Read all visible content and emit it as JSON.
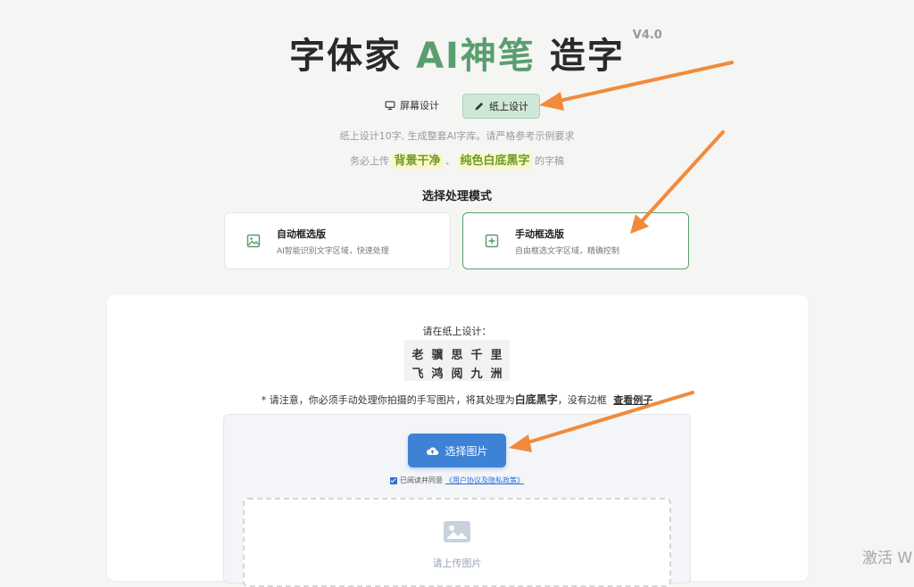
{
  "header": {
    "title_prefix": "字体家",
    "title_ai": "AI神笔",
    "title_suffix": "造字",
    "version": "V4.0"
  },
  "mode_tabs": [
    {
      "label": "屏幕设计",
      "icon": "monitor-icon",
      "active": false
    },
    {
      "label": "纸上设计",
      "icon": "pencil-icon",
      "active": true
    }
  ],
  "hints": {
    "line1": "纸上设计10字, 生成整套AI字库。请严格参考示例要求",
    "line2_prefix": "务必上传",
    "highlight1": "背景干净",
    "separator": "、",
    "highlight2": "纯色白底黑字",
    "line2_suffix": "的字稿"
  },
  "processing": {
    "section_title": "选择处理模式",
    "options": [
      {
        "title": "自动框选版",
        "desc": "AI智能识别文字区域，快速处理",
        "icon": "image-icon",
        "selected": false
      },
      {
        "title": "手动框选版",
        "desc": "自由框选文字区域，精确控制",
        "icon": "plus-square-icon",
        "selected": true
      }
    ]
  },
  "upload_panel": {
    "label": "请在纸上设计：",
    "sample_rows": [
      [
        "老",
        "骥",
        "思",
        "千",
        "里"
      ],
      [
        "飞",
        "鸿",
        "阅",
        "九",
        "洲"
      ]
    ],
    "notice_prefix": "* 请注意，你必须手动处理你拍摄的手写图片，将其处理为",
    "notice_bold": "白底黑字",
    "notice_suffix": "，没有边框",
    "example_link": "查看例子",
    "upload_button": "选择图片",
    "agree_text": "已阅读并同意",
    "policy_link": "《用户协议及隐私政策》",
    "dropzone_text": "请上传图片"
  },
  "watermark": "激活 W",
  "colors": {
    "brand_green": "#5a9e6f",
    "active_tab_bg": "#cfe7d6",
    "primary_blue": "#3e82d6",
    "highlight_bg": "#fbf6c6",
    "annotation_arrow": "#f28a3b"
  }
}
